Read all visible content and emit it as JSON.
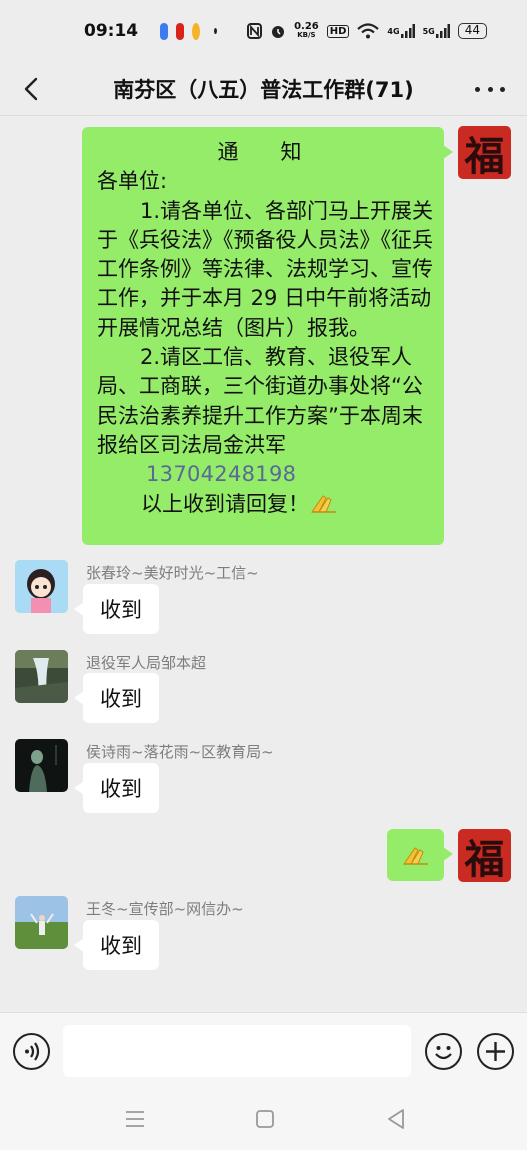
{
  "status_bar": {
    "time": "09:14",
    "speed": "0.26",
    "speed_unit": "KB/S",
    "hd": "HD",
    "net_4g": "4G",
    "net_5g": "5G",
    "battery": "44"
  },
  "header": {
    "title": "南芬区（八五）普法工作群(71)"
  },
  "notice": {
    "title": "通知",
    "greeting": "各单位:",
    "item1": "1.请各单位、各部门马上开展关于《兵役法》《预备役人员法》《征兵工作条例》等法律、法规学习、宣传工作，并于本月 29 日中午前将活动开展情况总结（图片）报我。",
    "item2": "2.请区工信、教育、退役军人局、工商联，三个街道办事处将“公民法治素养提升工作方案”于本周末报给区司法局金洪军",
    "phone": "13704248198",
    "confirm": "以上收到请回复！"
  },
  "messages": [
    {
      "sender": "张春玲~美好时光~工信~",
      "text": "收到"
    },
    {
      "sender": "退役军人局邹本超",
      "text": "收到"
    },
    {
      "sender": "侯诗雨~落花雨~区教育局~",
      "text": "收到"
    },
    {
      "sender": "王冬~宣传部~网信办~",
      "text": "收到"
    }
  ],
  "self_avatar_char": "福",
  "colors": {
    "bubble_self": "#95ec69",
    "link": "#576b95",
    "background": "#ededed"
  }
}
